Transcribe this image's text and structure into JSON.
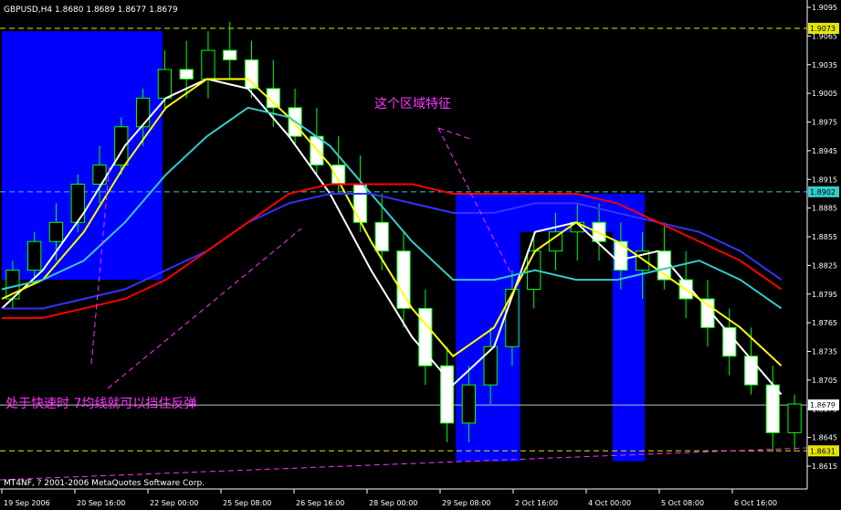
{
  "chart_data": {
    "type": "candlestick",
    "symbol_line": "GBPUSD,H4  1.8680 1.8689 1.8677 1.8679",
    "footer": "MT4NF, ? 2001-2006 MetaQuotes Software Corp.",
    "annotations": {
      "top": "这个区域特征",
      "bottom": "处于快速时 7均线就可以挡住反弹"
    },
    "y_ticks": [
      "1.9095",
      "1.9065",
      "1.9035",
      "1.9005",
      "1.8975",
      "1.8945",
      "1.8915",
      "1.8885",
      "1.8855",
      "1.8825",
      "1.8795",
      "1.8765",
      "1.8735",
      "1.8705",
      "1.8675",
      "1.8645",
      "1.8615"
    ],
    "x_ticks": [
      "19 Sep 2006",
      "20 Sep 16:00",
      "22 Sep 00:00",
      "25 Sep 08:00",
      "26 Sep 16:00",
      "28 Sep 00:00",
      "29 Sep 08:00",
      "2 Oct 16:00",
      "4 Oct 00:00",
      "5 Oct 08:00",
      "6 Oct 16:00"
    ],
    "hlines": [
      {
        "price": 1.9073,
        "label": "1.9073",
        "color": "#e6e600",
        "style": "dash"
      },
      {
        "price": 1.8902,
        "label": "1.8902",
        "color": "#33cccc",
        "style": "dash"
      },
      {
        "price": 1.8679,
        "label": "1.8679",
        "color": "#c0c0c0",
        "style": "solid"
      },
      {
        "price": 1.8631,
        "label": "1.8631",
        "color": "#e6e600",
        "style": "dash"
      }
    ],
    "ylim": [
      1.8615,
      1.9095
    ],
    "colors": {
      "bg": "#000000",
      "axis": "#ffffff",
      "bull": "#00ff00",
      "bear": "#00ff00",
      "box": "#0000ff",
      "ann": "#ff33ff"
    },
    "moving_averages": [
      {
        "color": "#ffffff",
        "values": [
          1.878,
          1.882,
          1.888,
          1.895,
          1.9,
          1.902,
          1.901,
          1.896,
          1.89,
          1.882,
          1.875,
          1.87,
          1.874,
          1.886,
          1.887,
          1.883,
          1.884,
          1.879,
          1.874,
          1.869
        ]
      },
      {
        "color": "#ffff00",
        "values": [
          1.879,
          1.881,
          1.886,
          1.893,
          1.899,
          1.902,
          1.902,
          1.898,
          1.893,
          1.885,
          1.878,
          1.873,
          1.876,
          1.884,
          1.887,
          1.885,
          1.882,
          1.879,
          1.876,
          1.872
        ]
      },
      {
        "color": "#33cccc",
        "values": [
          1.88,
          1.881,
          1.883,
          1.887,
          1.892,
          1.896,
          1.899,
          1.898,
          1.895,
          1.89,
          1.885,
          1.881,
          1.881,
          1.882,
          1.881,
          1.881,
          1.882,
          1.883,
          1.881,
          1.878
        ]
      },
      {
        "color": "#3333ff",
        "values": [
          1.878,
          1.878,
          1.879,
          1.88,
          1.882,
          1.884,
          1.887,
          1.889,
          1.89,
          1.89,
          1.889,
          1.888,
          1.888,
          1.889,
          1.889,
          1.888,
          1.887,
          1.886,
          1.884,
          1.881
        ]
      },
      {
        "color": "#ff0000",
        "values": [
          1.877,
          1.877,
          1.878,
          1.879,
          1.881,
          1.884,
          1.887,
          1.89,
          1.891,
          1.891,
          1.891,
          1.89,
          1.89,
          1.89,
          1.89,
          1.889,
          1.887,
          1.885,
          1.883,
          1.88
        ]
      }
    ],
    "boxes": [
      {
        "from": 0.0,
        "to": 0.2,
        "low": 1.881,
        "high": 1.907,
        "color": "#0000ff"
      },
      {
        "from": 0.565,
        "to": 0.645,
        "low": 1.862,
        "high": 1.89,
        "color": "#0000ff"
      },
      {
        "from": 0.645,
        "to": 0.8,
        "low": 1.862,
        "high": 1.89,
        "color": "#0000ff"
      },
      {
        "from": 0.645,
        "to": 0.76,
        "low": 1.862,
        "high": 1.886,
        "color": "#000000"
      }
    ],
    "ohlc": [
      [
        1.879,
        1.883,
        1.878,
        1.882
      ],
      [
        1.882,
        1.886,
        1.881,
        1.885
      ],
      [
        1.885,
        1.889,
        1.883,
        1.887
      ],
      [
        1.887,
        1.892,
        1.886,
        1.891
      ],
      [
        1.891,
        1.895,
        1.889,
        1.893
      ],
      [
        1.893,
        1.898,
        1.892,
        1.897
      ],
      [
        1.897,
        1.901,
        1.895,
        1.9
      ],
      [
        1.9,
        1.905,
        1.899,
        1.903
      ],
      [
        1.903,
        1.906,
        1.9,
        1.902
      ],
      [
        1.902,
        1.907,
        1.9,
        1.905
      ],
      [
        1.905,
        1.908,
        1.902,
        1.904
      ],
      [
        1.904,
        1.906,
        1.9,
        1.901
      ],
      [
        1.901,
        1.904,
        1.897,
        1.899
      ],
      [
        1.899,
        1.901,
        1.895,
        1.896
      ],
      [
        1.896,
        1.899,
        1.892,
        1.893
      ],
      [
        1.893,
        1.896,
        1.89,
        1.891
      ],
      [
        1.891,
        1.894,
        1.886,
        1.887
      ],
      [
        1.887,
        1.89,
        1.882,
        1.884
      ],
      [
        1.884,
        1.886,
        1.876,
        1.878
      ],
      [
        1.878,
        1.88,
        1.87,
        1.872
      ],
      [
        1.872,
        1.874,
        1.864,
        1.866
      ],
      [
        1.866,
        1.872,
        1.864,
        1.87
      ],
      [
        1.87,
        1.876,
        1.868,
        1.874
      ],
      [
        1.874,
        1.882,
        1.872,
        1.88
      ],
      [
        1.88,
        1.886,
        1.878,
        1.884
      ],
      [
        1.884,
        1.888,
        1.882,
        1.886
      ],
      [
        1.886,
        1.889,
        1.883,
        1.887
      ],
      [
        1.887,
        1.889,
        1.883,
        1.885
      ],
      [
        1.885,
        1.887,
        1.88,
        1.882
      ],
      [
        1.882,
        1.886,
        1.879,
        1.884
      ],
      [
        1.884,
        1.887,
        1.88,
        1.881
      ],
      [
        1.881,
        1.884,
        1.877,
        1.879
      ],
      [
        1.879,
        1.881,
        1.874,
        1.876
      ],
      [
        1.876,
        1.878,
        1.871,
        1.873
      ],
      [
        1.873,
        1.876,
        1.869,
        1.87
      ],
      [
        1.87,
        1.872,
        1.863,
        1.865
      ],
      [
        1.865,
        1.869,
        1.863,
        1.868
      ]
    ]
  }
}
